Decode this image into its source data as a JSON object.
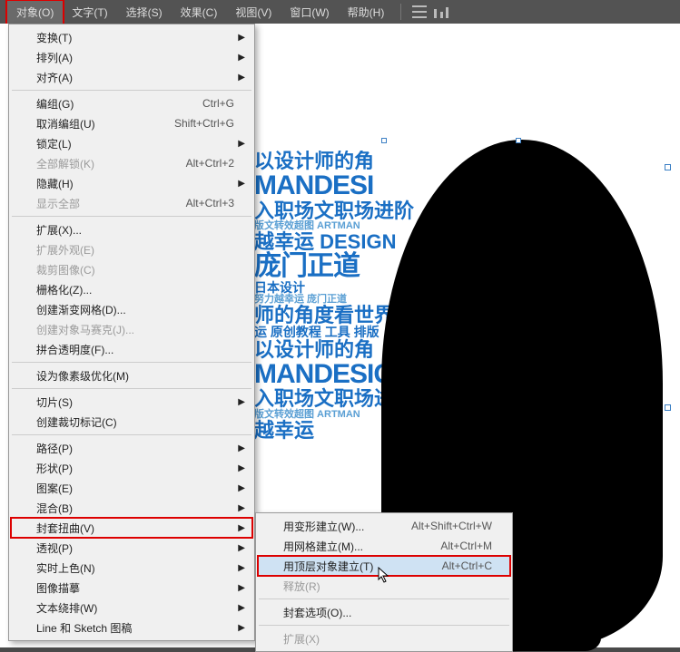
{
  "menubar": {
    "items": [
      "对象(O)",
      "文字(T)",
      "选择(S)",
      "效果(C)",
      "视图(V)",
      "窗口(W)",
      "帮助(H)"
    ]
  },
  "menu": {
    "items": [
      {
        "label": "变换(T)",
        "sub": true
      },
      {
        "label": "排列(A)",
        "sub": true
      },
      {
        "label": "对齐(A)",
        "sub": true
      },
      {
        "div": true
      },
      {
        "label": "编组(G)",
        "sc": "Ctrl+G"
      },
      {
        "label": "取消编组(U)",
        "sc": "Shift+Ctrl+G"
      },
      {
        "label": "锁定(L)",
        "sub": true
      },
      {
        "label": "全部解锁(K)",
        "sc": "Alt+Ctrl+2",
        "disabled": true
      },
      {
        "label": "隐藏(H)",
        "sub": true
      },
      {
        "label": "显示全部",
        "sc": "Alt+Ctrl+3",
        "disabled": true
      },
      {
        "div": true
      },
      {
        "label": "扩展(X)..."
      },
      {
        "label": "扩展外观(E)",
        "disabled": true
      },
      {
        "label": "裁剪图像(C)",
        "disabled": true
      },
      {
        "label": "栅格化(Z)..."
      },
      {
        "label": "创建渐变网格(D)..."
      },
      {
        "label": "创建对象马赛克(J)...",
        "disabled": true
      },
      {
        "label": "拼合透明度(F)..."
      },
      {
        "div": true
      },
      {
        "label": "设为像素级优化(M)"
      },
      {
        "div": true
      },
      {
        "label": "切片(S)",
        "sub": true
      },
      {
        "label": "创建裁切标记(C)"
      },
      {
        "div": true
      },
      {
        "label": "路径(P)",
        "sub": true
      },
      {
        "label": "形状(P)",
        "sub": true
      },
      {
        "label": "图案(E)",
        "sub": true
      },
      {
        "label": "混合(B)",
        "sub": true
      },
      {
        "label": "封套扭曲(V)",
        "sub": true,
        "hl": true
      },
      {
        "label": "透视(P)",
        "sub": true
      },
      {
        "label": "实时上色(N)",
        "sub": true
      },
      {
        "label": "图像描摹",
        "sub": true
      },
      {
        "label": "文本绕排(W)",
        "sub": true
      },
      {
        "label": "Line 和 Sketch 图稿",
        "sub": true
      }
    ]
  },
  "submenu": {
    "items": [
      {
        "label": "用变形建立(W)...",
        "sc": "Alt+Shift+Ctrl+W"
      },
      {
        "label": "用网格建立(M)...",
        "sc": "Alt+Ctrl+M"
      },
      {
        "label": "用顶层对象建立(T)",
        "sc": "Alt+Ctrl+C",
        "hl": true,
        "hov": true
      },
      {
        "label": "释放(R)",
        "disabled": true
      },
      {
        "div": true
      },
      {
        "label": "封套选项(O)..."
      },
      {
        "div": true
      },
      {
        "label": "扩展(X)",
        "disabled": true
      }
    ]
  },
  "art": {
    "l1": "以设计师的角",
    "l2": "MANDESI",
    "l3": "入职场文职场进阶",
    "l4": "版文转效超图 ARTMAN",
    "l5": "越幸运 DESIGN",
    "l6": "庞门正道",
    "l7": "日本设计",
    "l8": "努力越幸运 庞门正道",
    "l9": "师的角度看世界",
    "l10": "运 原创教程 工具 排版",
    "l11": "以设计师的角",
    "l12": "MANDESIG",
    "l13": "入职场文职场进阶 庞",
    "l14": "版文转效超图 ARTMAN",
    "l15": "越幸运"
  }
}
